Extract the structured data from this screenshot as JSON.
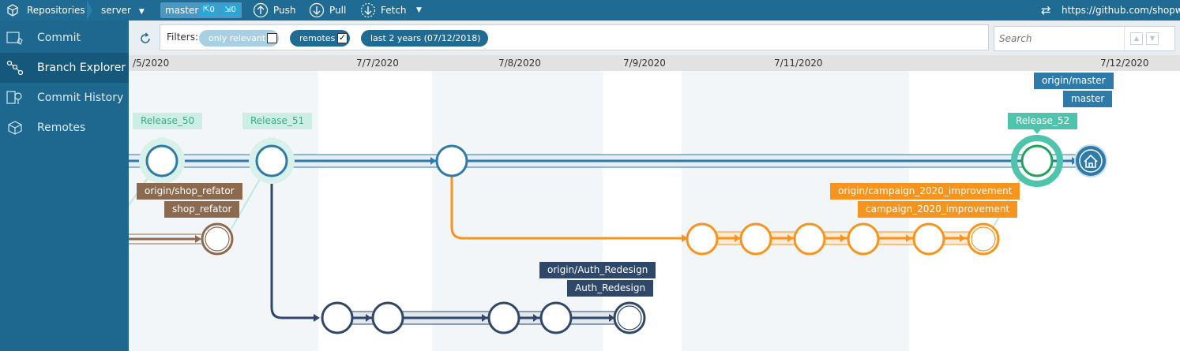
{
  "topbar": {
    "repositories_label": "Repositories",
    "repo_name": "server",
    "branch_name": "master",
    "incoming_count": "0",
    "outgoing_count": "0",
    "push_label": "Push",
    "pull_label": "Pull",
    "fetch_label": "Fetch",
    "remote_url": "https://github.com/shopway"
  },
  "sidebar": {
    "items": [
      {
        "label": "Commit",
        "icon": "commit-icon"
      },
      {
        "label": "Branch Explorer",
        "icon": "branch-explorer-icon"
      },
      {
        "label": "Commit History",
        "icon": "commit-history-icon"
      },
      {
        "label": "Remotes",
        "icon": "remotes-icon"
      }
    ]
  },
  "filters": {
    "label": "Filters:",
    "only_relevant": "only relevant",
    "only_relevant_checked": false,
    "remotes": "remotes",
    "remotes_checked": true,
    "date_range": "last 2 years (07/12/2018)",
    "search_placeholder": "Search"
  },
  "timeline": {
    "dates": [
      "/5/2020",
      "7/7/2020",
      "7/8/2020",
      "7/9/2020",
      "7/11/2020",
      "7/12/2020"
    ]
  },
  "labels": {
    "release_50": "Release_50",
    "release_51": "Release_51",
    "release_52": "Release_52",
    "origin_master": "origin/master",
    "master": "master",
    "origin_shop_refator": "origin/shop_refator",
    "shop_refator": "shop_refator",
    "origin_campaign": "origin/campaign_2020_improvement",
    "campaign": "campaign_2020_improvement",
    "origin_auth": "origin/Auth_Redesign",
    "auth": "Auth_Redesign"
  },
  "colors": {
    "master_branch": "#2e7aa8",
    "campaign_branch": "#f7941d",
    "auth_branch": "#2f4768",
    "shop_branch": "#8b6a50",
    "release_label": "#cdeee5",
    "release_52_label": "#4dc4ab",
    "remote_label": "#2e7aa8",
    "head_commit": "#1fa35b"
  }
}
